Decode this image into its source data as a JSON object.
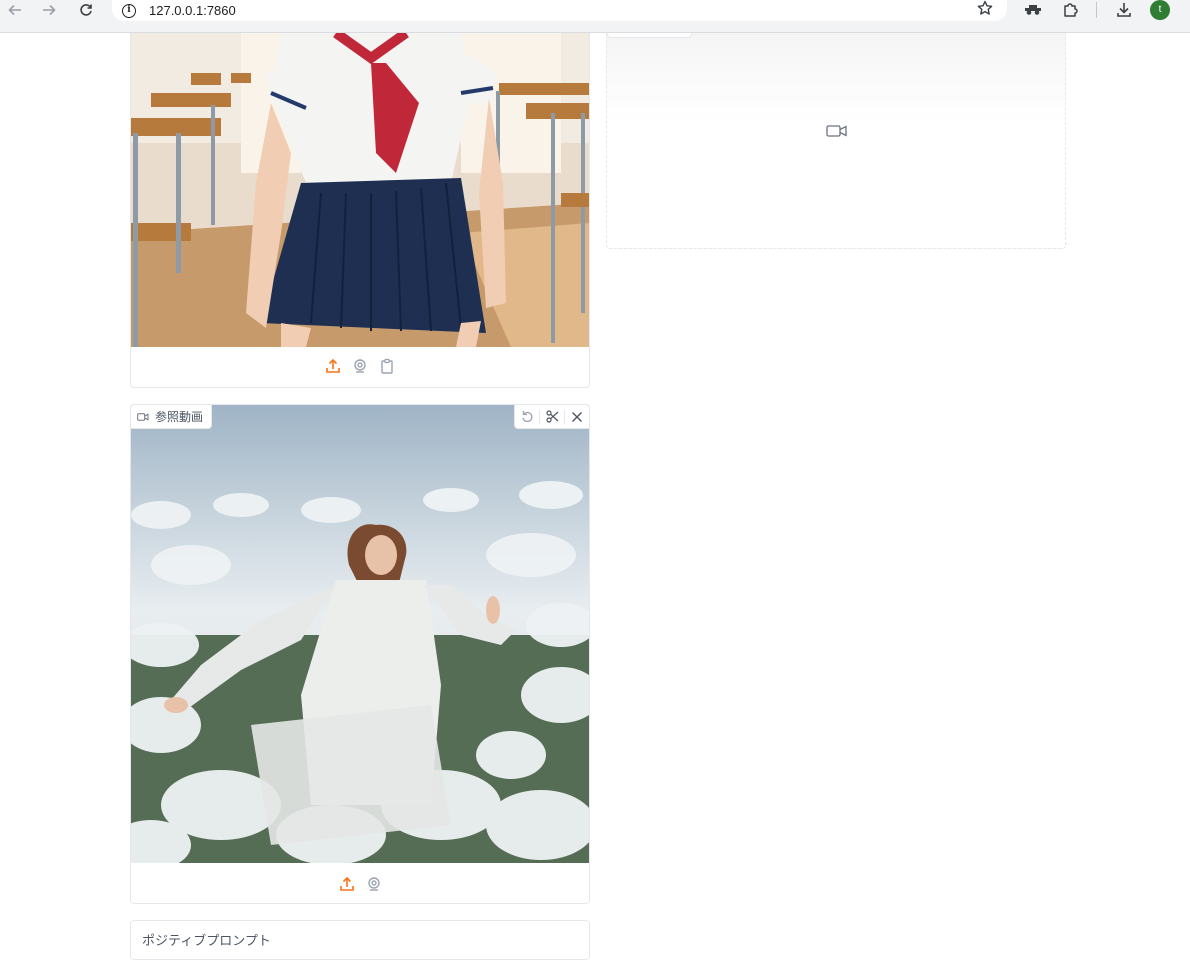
{
  "browser": {
    "url": "127.0.0.1:7860",
    "profile_initial": "t",
    "icons": [
      "back-icon",
      "forward-icon",
      "reload-icon",
      "site-info-icon",
      "bookmark-star-icon",
      "incognito-extension-icon",
      "extensions-puzzle-icon",
      "download-icon"
    ]
  },
  "input_image": {
    "icons": [
      "upload-icon",
      "webcam-icon",
      "clipboard-icon"
    ],
    "accent_color": "#f97316"
  },
  "reference_video": {
    "label": "参照動画",
    "tools": [
      "undo-icon",
      "trim-icon",
      "close-icon"
    ],
    "icons": [
      "upload-icon",
      "webcam-icon"
    ]
  },
  "prompt": {
    "label": "ポジティブプロンプト"
  },
  "output_video": {
    "icon": "video-camera-icon"
  }
}
